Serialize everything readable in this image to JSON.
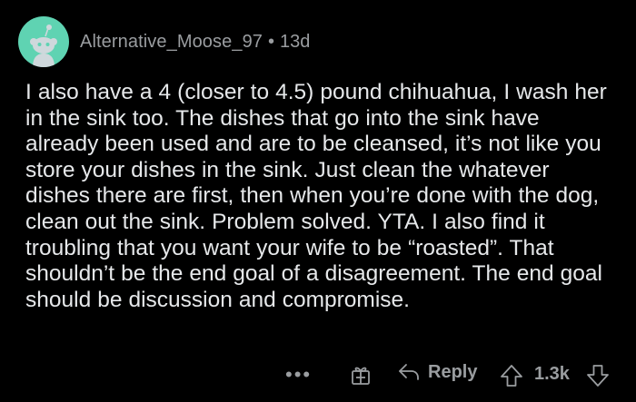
{
  "comment": {
    "author": "Alternative_Moose_97",
    "separator": "•",
    "age": "13d",
    "body": "I also have a 4 (closer to 4.5) pound chihuahua, I wash her in the sink too. The dishes that go into the sink have already been used and are to be cleansed, it’s not like you store your dishes in the sink. Just clean the whatever dishes there are first, then when you’re done with the dog, clean out the sink. Problem solved. YTA. I also find it troubling that you want your wife to be “roasted”. That shouldn’t be the end goal of a disagreement. The end goal should be discussion and compromise."
  },
  "actions": {
    "more_label": "•••",
    "reply_label": "Reply",
    "score": "1.3k"
  },
  "icons": {
    "avatar": "snoo-avatar-icon",
    "award": "gift-award-icon",
    "reply": "reply-arrow-icon",
    "upvote": "upvote-arrow-icon",
    "downvote": "downvote-arrow-icon"
  },
  "colors": {
    "background": "#000000",
    "text": "#e6e8ea",
    "muted": "#9a9da0",
    "avatar_bg": "#5fd3b2"
  }
}
